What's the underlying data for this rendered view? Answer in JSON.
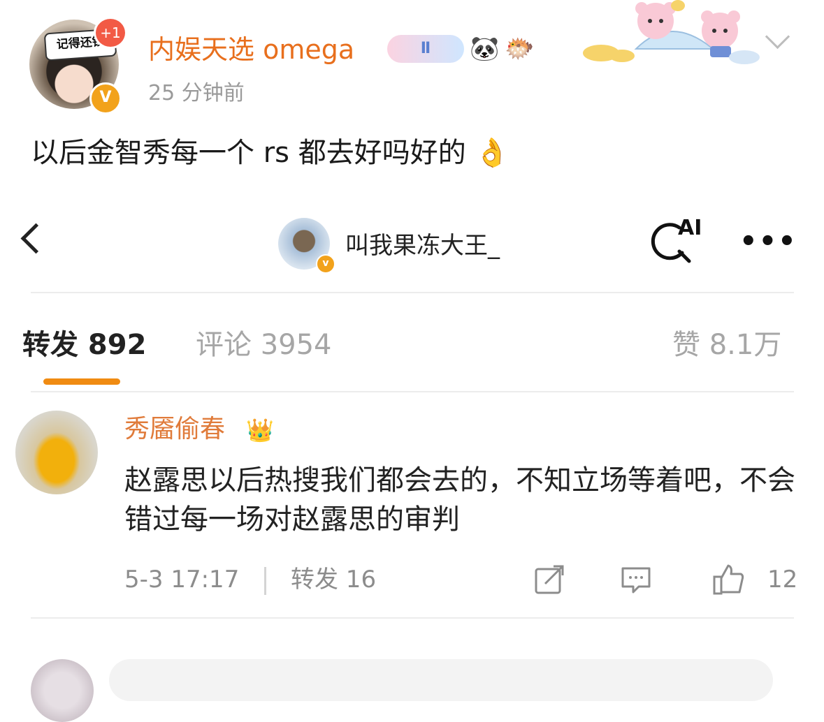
{
  "post": {
    "avatar_sign_text": "记得还钱",
    "notification_badge": "+1",
    "verified_mark": "V",
    "username": "内娱天选 omega",
    "medal_label": "Ⅱ",
    "emoji_1": "🐼",
    "emoji_2": "🐡",
    "time": "25 分钟前",
    "text": "以后金智秀每一个 rs 都去好吗好的 👌"
  },
  "screenshot": {
    "nav": {
      "account_name": "叫我果冻大王_",
      "verified_mark": "v",
      "ai_label": "AI",
      "more_label": "•••"
    },
    "tabs": [
      {
        "label": "转发 892"
      },
      {
        "label": "评论 3954"
      },
      {
        "label": "赞 8.1万"
      }
    ],
    "comment": {
      "user": "秀靥偷春",
      "crown": "👑",
      "text": "赵露思以后热搜我们都会去的，不知立场等着吧，不会错过每一场对赵露思的审判",
      "time": "5-3 17:17",
      "reposts": "转发 16",
      "likes": "12"
    }
  },
  "colors": {
    "username": "#e86f1d",
    "accent_orange": "#f08b12",
    "verified": "#f2a21b",
    "badge_red": "#f25a45",
    "muted_text": "#a6a6a6"
  }
}
